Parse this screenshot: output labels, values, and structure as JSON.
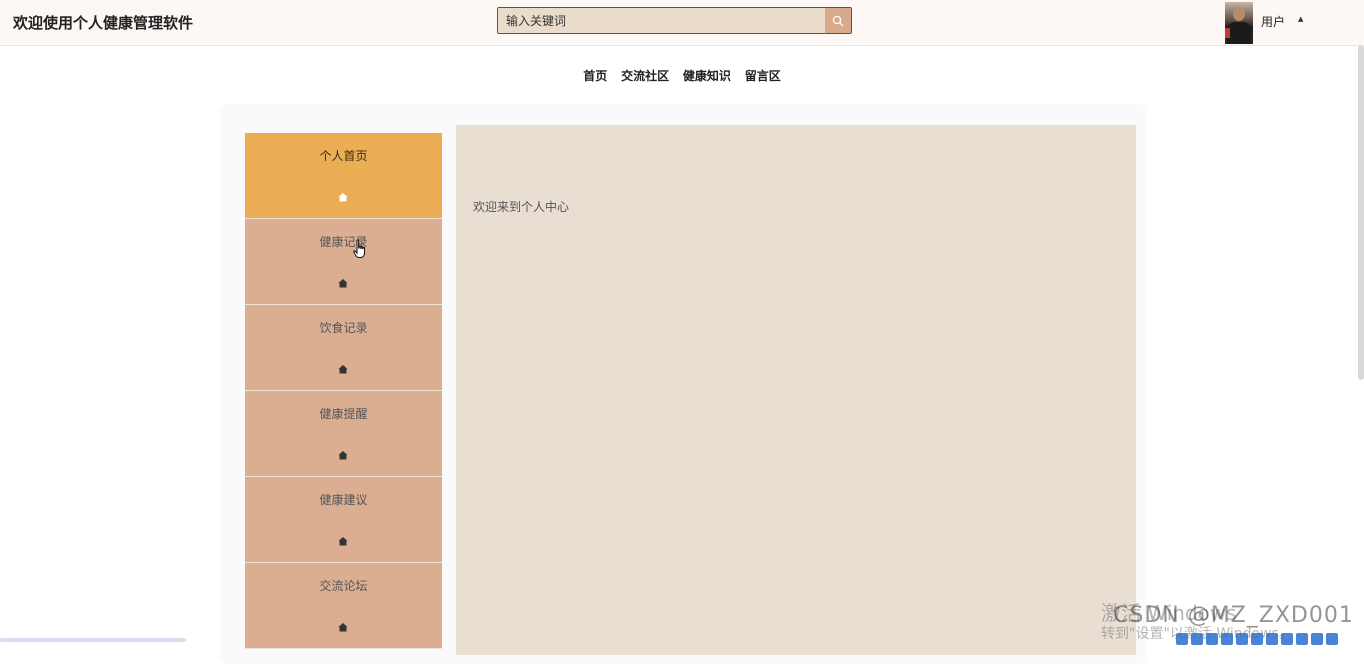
{
  "header": {
    "title": "欢迎使用个人健康管理软件",
    "search": {
      "placeholder": "输入关键词"
    },
    "user": {
      "name": "用户"
    }
  },
  "nav": {
    "items": [
      "首页",
      "交流社区",
      "健康知识",
      "留言区"
    ]
  },
  "sidebar": {
    "items": [
      {
        "label": "个人首页",
        "active": true
      },
      {
        "label": "健康记录",
        "active": false
      },
      {
        "label": "饮食记录",
        "active": false
      },
      {
        "label": "健康提醒",
        "active": false
      },
      {
        "label": "健康建议",
        "active": false
      },
      {
        "label": "交流论坛",
        "active": false
      }
    ]
  },
  "content": {
    "welcome": "欢迎来到个人中心"
  },
  "overlay": {
    "watermark_line1": "激活 Windows",
    "watermark_line2": "转到\"设置\"以激活 Windows。",
    "csdn": "CSDN @MZ_ZXD001"
  },
  "colors": {
    "accent_active": "#ecae55",
    "sidebar_bg": "#dbae92",
    "content_bg": "#e9ded2",
    "search_btn": "#d8a98c"
  }
}
